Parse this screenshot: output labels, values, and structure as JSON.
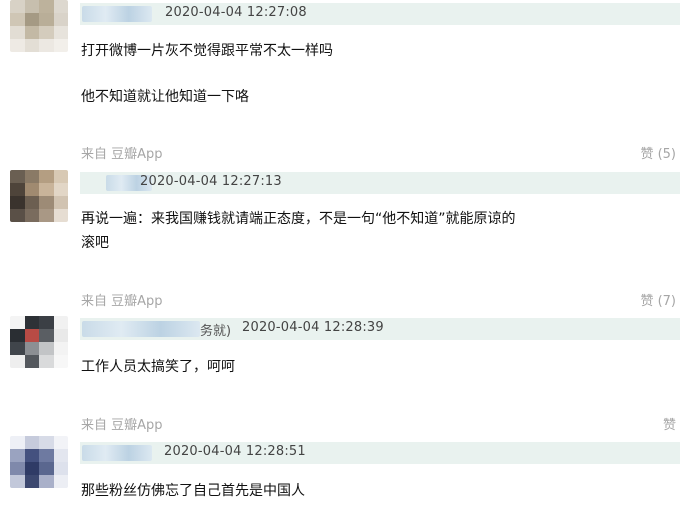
{
  "comments": [
    {
      "time": "2020-04-04 12:27:08",
      "lines": [
        "打开微博一片灰不觉得跟平常不太一样吗",
        "他不知道就让他知道一下咯"
      ],
      "source": "来自 豆瓣App",
      "like": "赞 (5)"
    },
    {
      "time": "2020-04-04 12:27:13",
      "lines": [
        "再说一遍：来我国赚钱就请端正态度，不是一句“他不知道”就能原谅的",
        "滚吧"
      ],
      "source": "来自 豆瓣App",
      "like": "赞 (7)"
    },
    {
      "name_suffix": "务就)",
      "time": "2020-04-04 12:28:39",
      "lines": [
        "工作人员太搞笑了，呵呵"
      ],
      "source": "来自 豆瓣App",
      "like": "赞"
    },
    {
      "time": "2020-04-04 12:28:51",
      "lines": [
        "那些粉丝仿佛忘了自己首先是中国人"
      ]
    }
  ]
}
